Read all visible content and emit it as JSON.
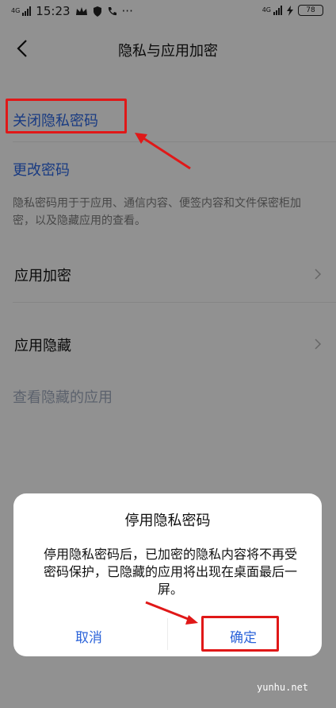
{
  "status_bar": {
    "time": "15:23",
    "network_left": "4G",
    "network_right": "4G",
    "battery": "78",
    "more": "···"
  },
  "header": {
    "title": "隐私与应用加密",
    "back_icon": "chevron-left-icon"
  },
  "settings": {
    "close_password": "关闭隐私密码",
    "change_password": "更改密码",
    "description": "隐私密码用于于应用、通信内容、便签内容和文件保密柜加密，以及隐藏应用的查看。",
    "items": [
      {
        "label": "应用加密"
      },
      {
        "label": "应用隐藏"
      }
    ],
    "view_hidden": "查看隐藏的应用"
  },
  "dialog": {
    "title": "停用隐私密码",
    "message": "停用隐私密码后，已加密的隐私内容将不再受密码保护，已隐藏的应用将出现在桌面最后一屏。",
    "cancel": "取消",
    "confirm": "确定"
  },
  "watermark": "yunhu.net",
  "colors": {
    "accent": "#2b63d9",
    "highlight": "#e01818"
  }
}
